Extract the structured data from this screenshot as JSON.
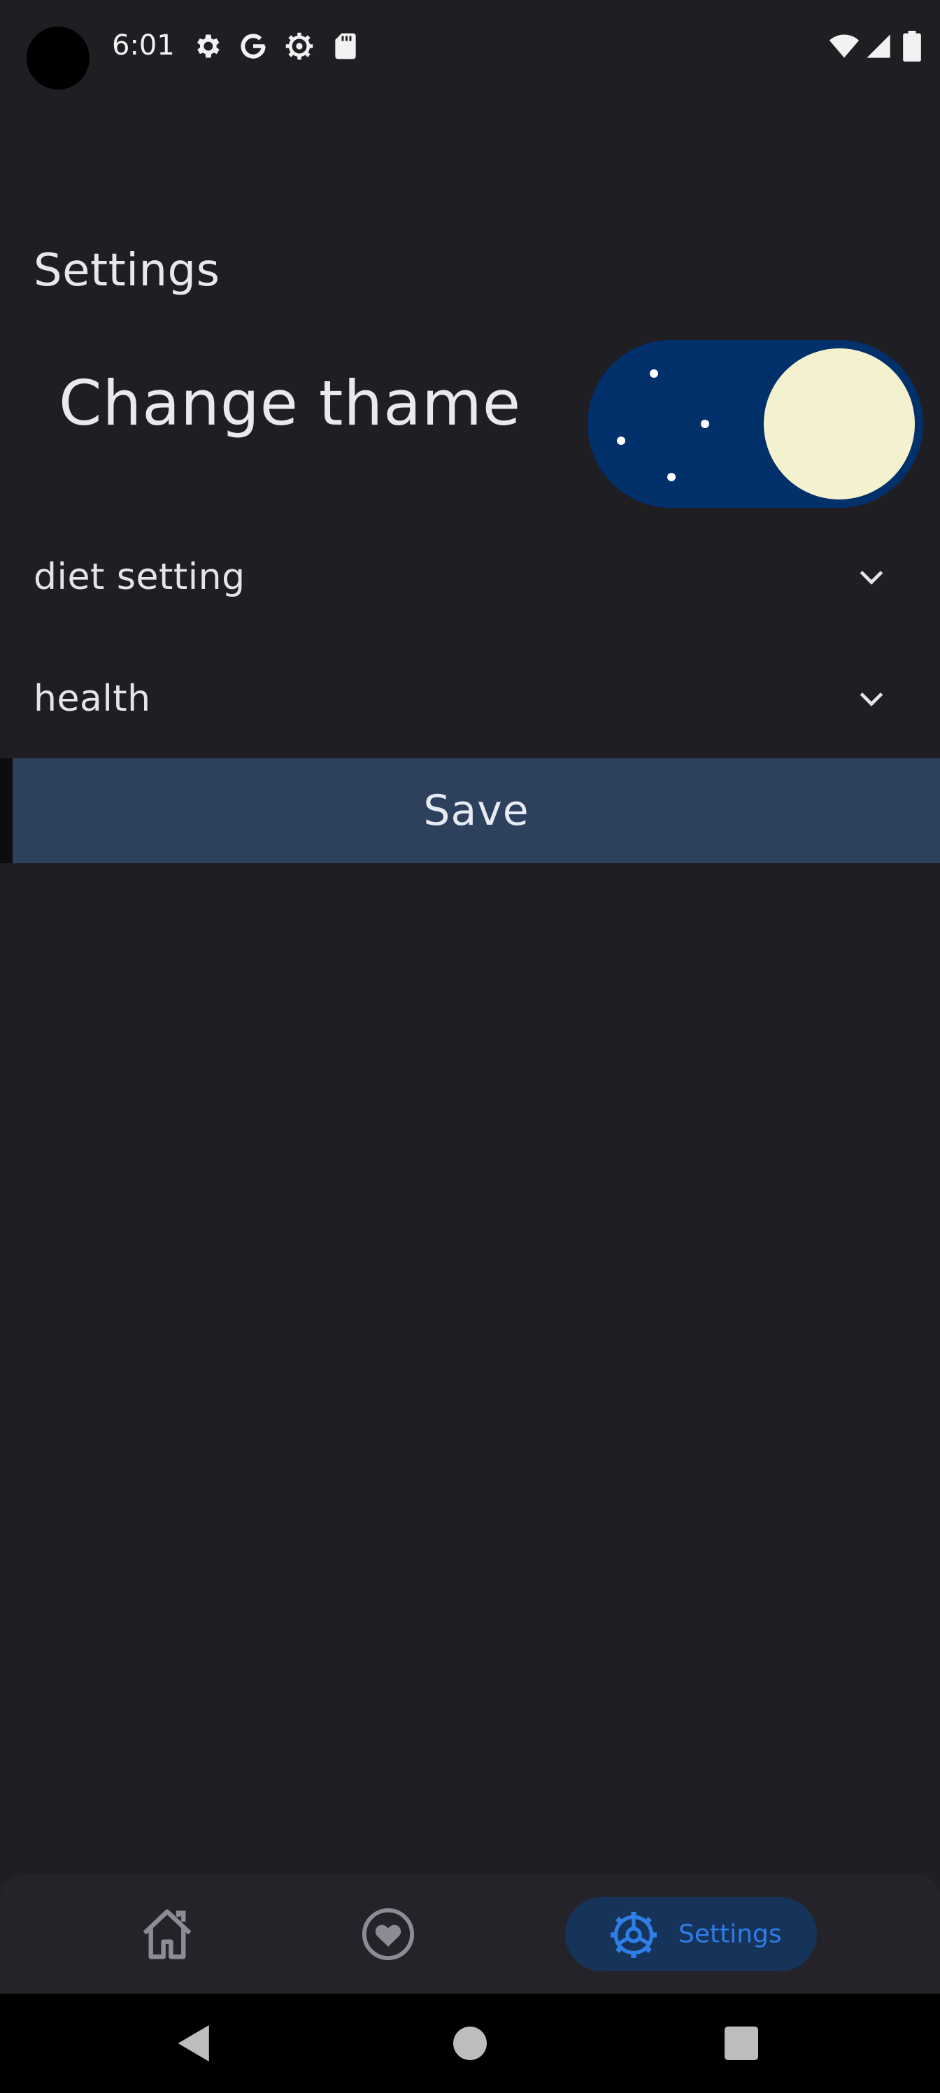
{
  "status_bar": {
    "time": "6:01",
    "icons_left": [
      "settings-gear-icon",
      "google-g-icon",
      "settings-cog-icon",
      "sd-card-icon"
    ],
    "icons_right": [
      "wifi-icon",
      "signal-icon",
      "battery-icon"
    ]
  },
  "page": {
    "title": "Settings"
  },
  "theme": {
    "label": "Change thame",
    "toggle_state": "dark",
    "colors": {
      "track": "#02306a",
      "moon": "#f3f1ce",
      "stars": "#ffffff"
    }
  },
  "accordions": [
    {
      "label": "diet setting",
      "icon": "chevron-down-icon"
    },
    {
      "label": "health",
      "icon": "chevron-down-icon"
    }
  ],
  "save": {
    "label": "Save",
    "color": "#2d415d"
  },
  "bottom_nav": {
    "items": [
      {
        "icon": "home-icon",
        "label": ""
      },
      {
        "icon": "favorite-heart-icon",
        "label": ""
      },
      {
        "icon": "settings-icon",
        "label": "Settings",
        "selected": true
      }
    ],
    "accent": "#2f7de6"
  },
  "system_nav": [
    "back-icon",
    "home-circle-icon",
    "recents-square-icon"
  ],
  "colors": {
    "background": "#1f1e23"
  }
}
